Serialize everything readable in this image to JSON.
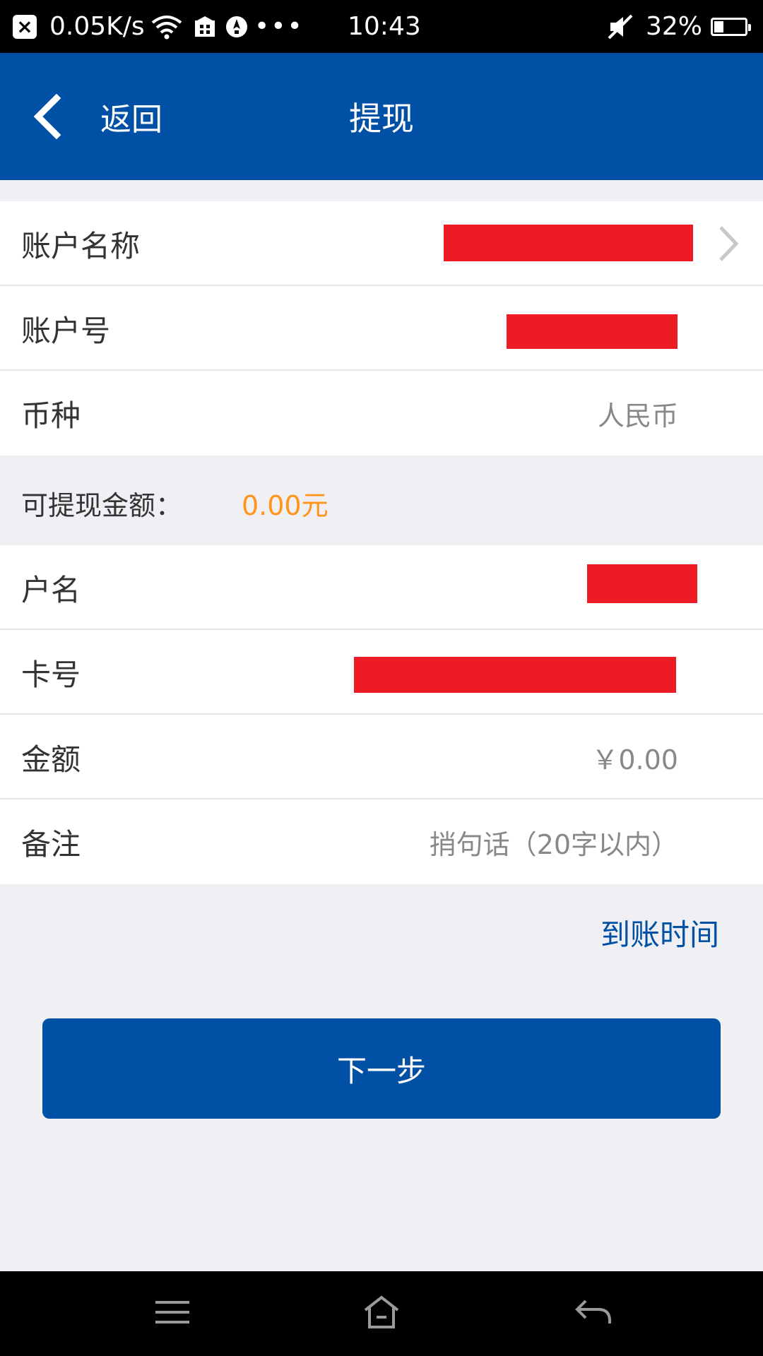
{
  "status_bar": {
    "net_speed": "0.05K/s",
    "more": "•••",
    "time": "10:43",
    "battery_percent": "32%",
    "battery_level": 0.32,
    "icons": [
      "close-icon",
      "wifi-icon",
      "store-icon",
      "notification-icon",
      "mute-icon",
      "battery-icon"
    ]
  },
  "nav": {
    "back_label": "返回",
    "title": "提现"
  },
  "account_section": {
    "rows": [
      {
        "label": "账户名称",
        "value": "",
        "redacted": true,
        "has_chevron": true
      },
      {
        "label": "账户号",
        "value": "",
        "redacted": true
      },
      {
        "label": "币种",
        "value": "人民币"
      }
    ]
  },
  "balance": {
    "label": "可提现金额：",
    "amount": "0.00元"
  },
  "withdraw_section": {
    "rows": [
      {
        "label": "户名",
        "value": "",
        "redacted": true
      },
      {
        "label": "卡号",
        "value": "",
        "redacted": true
      },
      {
        "label": "金额",
        "placeholder": "￥0.00"
      },
      {
        "label": "备注",
        "placeholder": "捎句话（20字以内）"
      }
    ]
  },
  "arrival_time_link": "到账时间",
  "next_button": "下一步",
  "colors": {
    "brand_blue": "#0050a5",
    "amount_orange": "#ff9419",
    "redaction_red": "#ed1c24",
    "page_bg": "#efeff4"
  }
}
